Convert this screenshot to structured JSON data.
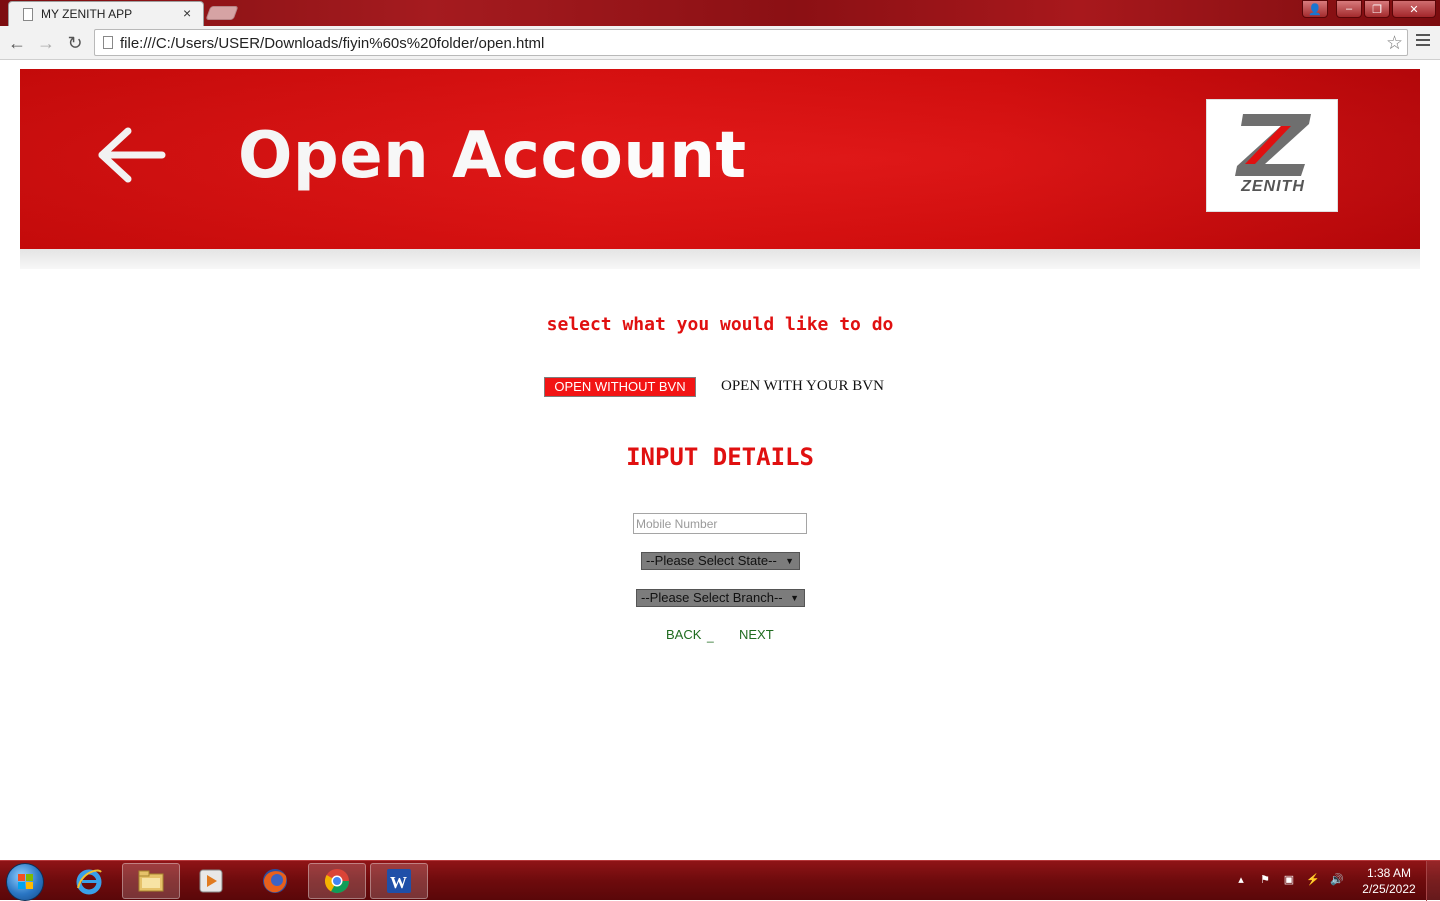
{
  "browser": {
    "tab_title": "MY ZENITH APP",
    "tab_close": "×",
    "url": "file:///C:/Users/USER/Downloads/fiyin%60s%20folder/open.html",
    "nav_back": "←",
    "nav_forward": "→",
    "nav_reload": "↻",
    "star": "☆",
    "window_buttons": {
      "user": "👤",
      "minimize": "–",
      "restore": "❐",
      "close": "✕"
    }
  },
  "banner": {
    "title": "Open Account",
    "logo_text": "ZENITH",
    "background": "#d90c0c"
  },
  "page": {
    "prompt": "select what you would like to do",
    "option_without_bvn": "OPEN WITHOUT BVN",
    "option_with_bvn": "OPEN WITH YOUR BVN",
    "section_title": "INPUT DETAILS",
    "mobile_placeholder": "Mobile Number",
    "state_select": "--Please Select State--",
    "branch_select": "--Please Select Branch--",
    "back_link": "BACK",
    "underscore": "_",
    "next_link": "NEXT"
  },
  "colors": {
    "accent_red": "#e01010",
    "link_green": "#1f6b1f"
  },
  "taskbar": {
    "apps": [
      "internet-explorer",
      "file-explorer",
      "media-player",
      "firefox",
      "chrome",
      "word"
    ],
    "active_app": "chrome",
    "time": "1:38 AM",
    "date": "2/25/2022"
  }
}
